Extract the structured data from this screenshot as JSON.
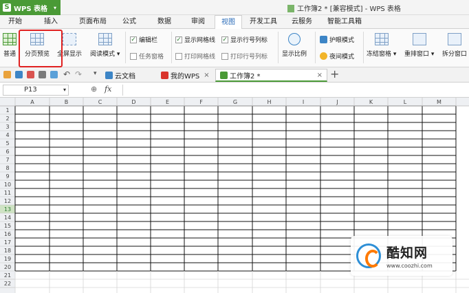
{
  "app": {
    "button_label": "WPS 表格",
    "logo_glyph": "S"
  },
  "window": {
    "title": "工作簿2 * [兼容模式] - WPS 表格"
  },
  "menu": [
    {
      "label": "开始"
    },
    {
      "label": "插入"
    },
    {
      "label": "页面布局"
    },
    {
      "label": "公式"
    },
    {
      "label": "数据"
    },
    {
      "label": "审阅"
    },
    {
      "label": "视图"
    },
    {
      "label": "开发工具"
    },
    {
      "label": "云服务"
    },
    {
      "label": "智能工具箱"
    }
  ],
  "active_menu": "视图",
  "ribbon": {
    "normal": "普通",
    "page_break_preview": "分页预览",
    "full_screen": "全屏显示",
    "reading_mode": "阅读模式",
    "edit_bar": "编辑栏",
    "task_pane": "任务窗格",
    "show_gridlines": "显示网格线",
    "print_gridlines": "打印网格线",
    "show_headers": "显示行号列标",
    "print_headers": "打印行号列标",
    "zoom": "显示比例",
    "eye_protect": "护眼模式",
    "night_mode": "夜间模式",
    "freeze": "冻结窗格",
    "rearrange": "重排窗口",
    "split": "拆分窗口",
    "checked": {
      "edit_bar": true,
      "task_pane": false,
      "show_gridlines": true,
      "print_gridlines": false,
      "show_headers": true,
      "print_headers": false
    }
  },
  "tabs": [
    {
      "label": "云文档",
      "icon": "cloud-doc-icon"
    },
    {
      "label": "我的WPS",
      "icon": "wps-logo-icon"
    },
    {
      "label": "工作簿2 *",
      "icon": "spreadsheet-icon"
    }
  ],
  "formula_bar": {
    "cell_ref": "P13",
    "fx_label": "fx"
  },
  "columns": [
    "A",
    "B",
    "C",
    "D",
    "E",
    "F",
    "G",
    "H",
    "I",
    "J",
    "K",
    "L",
    "M"
  ],
  "rows": [
    "1",
    "2",
    "3",
    "4",
    "5",
    "6",
    "7",
    "8",
    "9",
    "10",
    "11",
    "12",
    "13",
    "14",
    "15",
    "16",
    "17",
    "18",
    "19",
    "20",
    "21",
    "22"
  ],
  "active_row": "13",
  "bordered_last_row": "20",
  "watermark": {
    "name": "酷知网",
    "url": "www.coozhi.com"
  },
  "colors": {
    "brand_green": "#4a9a36",
    "highlight_red": "#e02020",
    "active_blue": "#2a6bb8"
  }
}
